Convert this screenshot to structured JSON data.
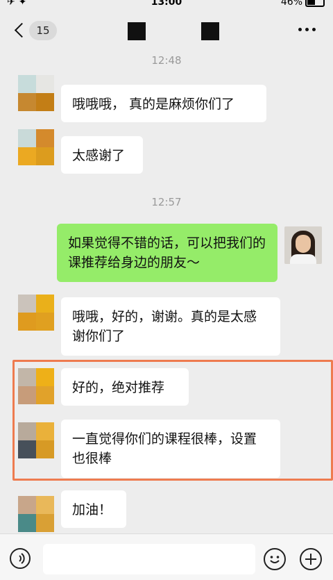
{
  "status_bar": {
    "left_glyphs": "✈ ✦",
    "time": "13:00",
    "battery": "46%"
  },
  "header": {
    "back_badge": "15",
    "more_icon": "more-dots-icon"
  },
  "chat": {
    "timestamps": [
      "12:48",
      "12:57"
    ],
    "messages": [
      {
        "side": "in",
        "text": "哦哦哦， 真的是麻烦你们了"
      },
      {
        "side": "in",
        "text": "太感谢了"
      },
      {
        "side": "out",
        "text": "如果觉得不错的话，可以把我们的课推荐给身边的朋友～"
      },
      {
        "side": "in",
        "text": "哦哦，好的，谢谢。真的是太感谢你们了"
      },
      {
        "side": "in",
        "text": "好的，绝对推荐"
      },
      {
        "side": "in",
        "text": "一直觉得你们的课程很棒，设置也很棒"
      },
      {
        "side": "in",
        "text": "加油！"
      }
    ]
  },
  "colors": {
    "background": "#ededed",
    "incoming_bubble": "#ffffff",
    "outgoing_bubble": "#95ec69",
    "highlight_border": "#ee7b4f"
  },
  "input_bar": {
    "voice_icon": "voice-icon",
    "emoji_icon": "emoji-icon",
    "plus_icon": "plus-icon",
    "placeholder": ""
  }
}
